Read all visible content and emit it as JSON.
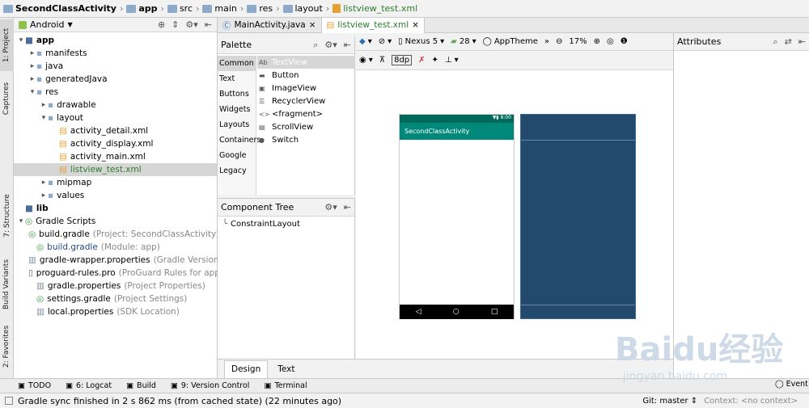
{
  "breadcrumb": [
    {
      "label": "SecondClassActivity",
      "bold": true,
      "icon": "project-folder-icon"
    },
    {
      "label": "app",
      "bold": true,
      "icon": "module-folder-icon"
    },
    {
      "label": "src",
      "bold": false,
      "icon": "folder-icon"
    },
    {
      "label": "main",
      "bold": false,
      "icon": "folder-icon"
    },
    {
      "label": "res",
      "bold": false,
      "icon": "folder-icon"
    },
    {
      "label": "layout",
      "bold": false,
      "icon": "folder-icon"
    },
    {
      "label": "listview_test.xml",
      "bold": false,
      "icon": "xml-file-icon"
    }
  ],
  "left_stripe": {
    "project": "1: Project",
    "captures": "Captures",
    "structure": "7: Structure",
    "build_variants": "Build Variants",
    "favorites": "2: Favorites"
  },
  "project_panel": {
    "view_selector": "Android"
  },
  "tree": [
    {
      "label": "app",
      "indent": 0,
      "arrow": "down",
      "icon": "module",
      "bold": true
    },
    {
      "label": "manifests",
      "indent": 1,
      "arrow": "right",
      "icon": "folder"
    },
    {
      "label": "java",
      "indent": 1,
      "arrow": "right",
      "icon": "folder"
    },
    {
      "label": "generatedJava",
      "indent": 1,
      "arrow": "right",
      "icon": "folder"
    },
    {
      "label": "res",
      "indent": 1,
      "arrow": "down",
      "icon": "folder"
    },
    {
      "label": "drawable",
      "indent": 2,
      "arrow": "right",
      "icon": "folder"
    },
    {
      "label": "layout",
      "indent": 2,
      "arrow": "down",
      "icon": "folder"
    },
    {
      "label": "activity_detail.xml",
      "indent": 3,
      "icon": "xml"
    },
    {
      "label": "activity_display.xml",
      "indent": 3,
      "icon": "xml"
    },
    {
      "label": "activity_main.xml",
      "indent": 3,
      "icon": "xml"
    },
    {
      "label": "listview_test.xml",
      "indent": 3,
      "icon": "xml",
      "selected": true,
      "green": true
    },
    {
      "label": "mipmap",
      "indent": 2,
      "arrow": "right",
      "icon": "folder"
    },
    {
      "label": "values",
      "indent": 2,
      "arrow": "right",
      "icon": "folder"
    },
    {
      "label": "lib",
      "indent": 0,
      "icon": "module",
      "bold": true
    },
    {
      "label": "Gradle Scripts",
      "indent": 0,
      "arrow": "down",
      "icon": "gradle"
    },
    {
      "label": "build.gradle",
      "note": "(Project: SecondClassActivity)",
      "indent": 1,
      "icon": "gradle"
    },
    {
      "label": "build.gradle",
      "note": "(Module: app)",
      "indent": 1,
      "icon": "gradle",
      "blue": true
    },
    {
      "label": "gradle-wrapper.properties",
      "note": "(Gradle Version)",
      "indent": 1,
      "icon": "props"
    },
    {
      "label": "proguard-rules.pro",
      "note": "(ProGuard Rules for app)",
      "indent": 1,
      "icon": "pro"
    },
    {
      "label": "gradle.properties",
      "note": "(Project Properties)",
      "indent": 1,
      "icon": "props"
    },
    {
      "label": "settings.gradle",
      "note": "(Project Settings)",
      "indent": 1,
      "icon": "gradle"
    },
    {
      "label": "local.properties",
      "note": "(SDK Location)",
      "indent": 1,
      "icon": "props"
    }
  ],
  "editor_tabs": [
    {
      "label": "MainActivity.java",
      "icon": "java-class-icon",
      "active": false
    },
    {
      "label": "listview_test.xml",
      "icon": "xml-file-icon",
      "active": true
    }
  ],
  "palette": {
    "title": "Palette",
    "categories": [
      "Common",
      "Text",
      "Buttons",
      "Widgets",
      "Layouts",
      "Containers",
      "Google",
      "Legacy"
    ],
    "items": [
      {
        "label": "TextView",
        "glyph": "Ab",
        "selected": true
      },
      {
        "label": "Button",
        "glyph": "▬"
      },
      {
        "label": "ImageView",
        "glyph": "▣"
      },
      {
        "label": "RecyclerView",
        "glyph": "☰"
      },
      {
        "label": "<fragment>",
        "glyph": "<>"
      },
      {
        "label": "ScrollView",
        "glyph": "▤"
      },
      {
        "label": "Switch",
        "glyph": "●"
      }
    ]
  },
  "component_tree": {
    "title": "Component Tree",
    "root": "ConstraintLayout"
  },
  "design_toolbar": {
    "device": "Nexus 5",
    "api": "28",
    "theme": "AppTheme",
    "zoom": "17%",
    "margin": "8dp"
  },
  "preview": {
    "status_time": "8:00",
    "app_title": "SecondClassActivity",
    "nav": [
      "◁",
      "○",
      "□"
    ]
  },
  "attributes": {
    "title": "Attributes"
  },
  "bottom_tabs": {
    "design": "Design",
    "text": "Text"
  },
  "tool_windows": [
    {
      "label": "TODO",
      "icon": "todo-icon"
    },
    {
      "label": "6: Logcat",
      "icon": "logcat-icon"
    },
    {
      "label": "Build",
      "icon": "build-icon"
    },
    {
      "label": "9: Version Control",
      "icon": "vcs-icon"
    },
    {
      "label": "Terminal",
      "icon": "terminal-icon"
    }
  ],
  "event_log": "Event",
  "status": {
    "message": "Gradle sync finished in 2 s 862 ms (from cached state) (22 minutes ago)",
    "git": "Git: master ⇕",
    "context": "Context: <no context>"
  },
  "watermark": {
    "brand": "Baidu经验",
    "url": "jingyan.baidu.com"
  }
}
